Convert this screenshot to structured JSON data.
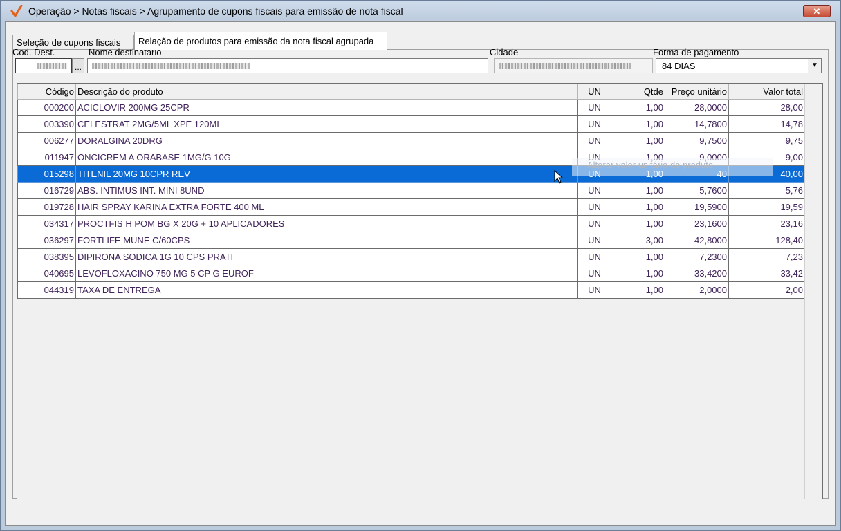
{
  "window": {
    "title": "Operação > Notas fiscais > Agrupamento de cupons fiscais para emissão de nota fiscal",
    "close_label": "✕"
  },
  "tabs": [
    {
      "label": "Seleção de cupons fiscais",
      "active": false
    },
    {
      "label": "Relação de produtos para emissão da nota fiscal agrupada",
      "active": true
    }
  ],
  "form": {
    "cod_dest_label": "Cod. Dest.",
    "nome_label": "Nome destinatário",
    "cidade_label": "Cidade",
    "forma_label": "Forma de pagamento",
    "browse_label": "...",
    "forma_value": "84 DIAS"
  },
  "grid": {
    "columns": [
      "Código",
      "Descrição do produto",
      "UN",
      "Qtde",
      "Preço unitário",
      "Valor total"
    ],
    "rows": [
      {
        "codigo": "000200",
        "descricao": "ACICLOVIR 200MG 25CPR",
        "un": "UN",
        "qtde": "1,00",
        "preco": "28,0000",
        "total": "28,00"
      },
      {
        "codigo": "003390",
        "descricao": "CELESTRAT 2MG/5ML XPE 120ML",
        "un": "UN",
        "qtde": "1,00",
        "preco": "14,7800",
        "total": "14,78"
      },
      {
        "codigo": "006277",
        "descricao": "DORALGINA 20DRG",
        "un": "UN",
        "qtde": "1,00",
        "preco": "9,7500",
        "total": "9,75"
      },
      {
        "codigo": "011947",
        "descricao": "ONCICREM A ORABASE 1MG/G 10G",
        "un": "UN",
        "qtde": "1,00",
        "preco": "9,0000",
        "total": "9,00"
      },
      {
        "codigo": "015298",
        "descricao": "TITENIL 20MG 10CPR REV",
        "un": "UN",
        "qtde": "1,00",
        "preco": "40",
        "total": "40,00",
        "selected": true
      },
      {
        "codigo": "016729",
        "descricao": "ABS. INTIMUS INT. MINI 8UND",
        "un": "UN",
        "qtde": "1,00",
        "preco": "5,7600",
        "total": "5,76"
      },
      {
        "codigo": "019728",
        "descricao": "HAIR SPRAY KARINA EXTRA FORTE 400 ML",
        "un": "UN",
        "qtde": "1,00",
        "preco": "19,5900",
        "total": "19,59"
      },
      {
        "codigo": "034317",
        "descricao": "PROCTFIS H POM BG X 20G + 10 APLICADORES",
        "un": "UN",
        "qtde": "1,00",
        "preco": "23,1600",
        "total": "23,16"
      },
      {
        "codigo": "036297",
        "descricao": "FORTLIFE MUNE C/60CPS",
        "un": "UN",
        "qtde": "3,00",
        "preco": "42,8000",
        "total": "128,40"
      },
      {
        "codigo": "038395",
        "descricao": "DIPIRONA SODICA 1G 10 CPS PRATI",
        "un": "UN",
        "qtde": "1,00",
        "preco": "7,2300",
        "total": "7,23"
      },
      {
        "codigo": "040695",
        "descricao": "LEVOFLOXACINO 750 MG 5 CP G EUROF",
        "un": "UN",
        "qtde": "1,00",
        "preco": "33,4200",
        "total": "33,42"
      },
      {
        "codigo": "044319",
        "descricao": "TAXA DE ENTREGA",
        "un": "UN",
        "qtde": "1,00",
        "preco": "2,0000",
        "total": "2,00"
      }
    ]
  },
  "tooltip": "Alterar valor unitário do produto",
  "colors": {
    "selection": "#0a6bd6",
    "text": "#40245a",
    "accent": "#e2611a"
  }
}
